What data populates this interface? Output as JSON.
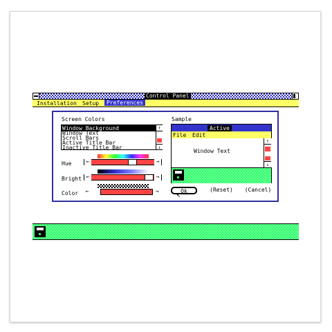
{
  "window": {
    "title": "Control Panel",
    "menu": [
      "Installation",
      "Setup",
      "Preferences"
    ]
  },
  "dialog": {
    "screen_colors_label": "Screen Colors",
    "items": [
      "Window Background",
      "Window Text",
      "Scroll Bars",
      "Active Title Bar",
      "Inactive Title Bar"
    ],
    "selected_index": 0,
    "hue_label": "Hue",
    "bright_label": "Bright",
    "color_label": "Color",
    "sample_label": "Sample",
    "sample_title": "Active",
    "sample_menu": [
      "File",
      "Edit"
    ],
    "sample_text": "Window Text",
    "ok_label": "Ok",
    "reset_label": "Reset",
    "cancel_label": "Cancel"
  },
  "colors": {
    "menu_bar": "#ffff66",
    "menu_selected": "#3333cc",
    "dialog_border": "#2f2f9f",
    "slider_red": "#ff4444",
    "desktop_green": "#33ff66"
  }
}
